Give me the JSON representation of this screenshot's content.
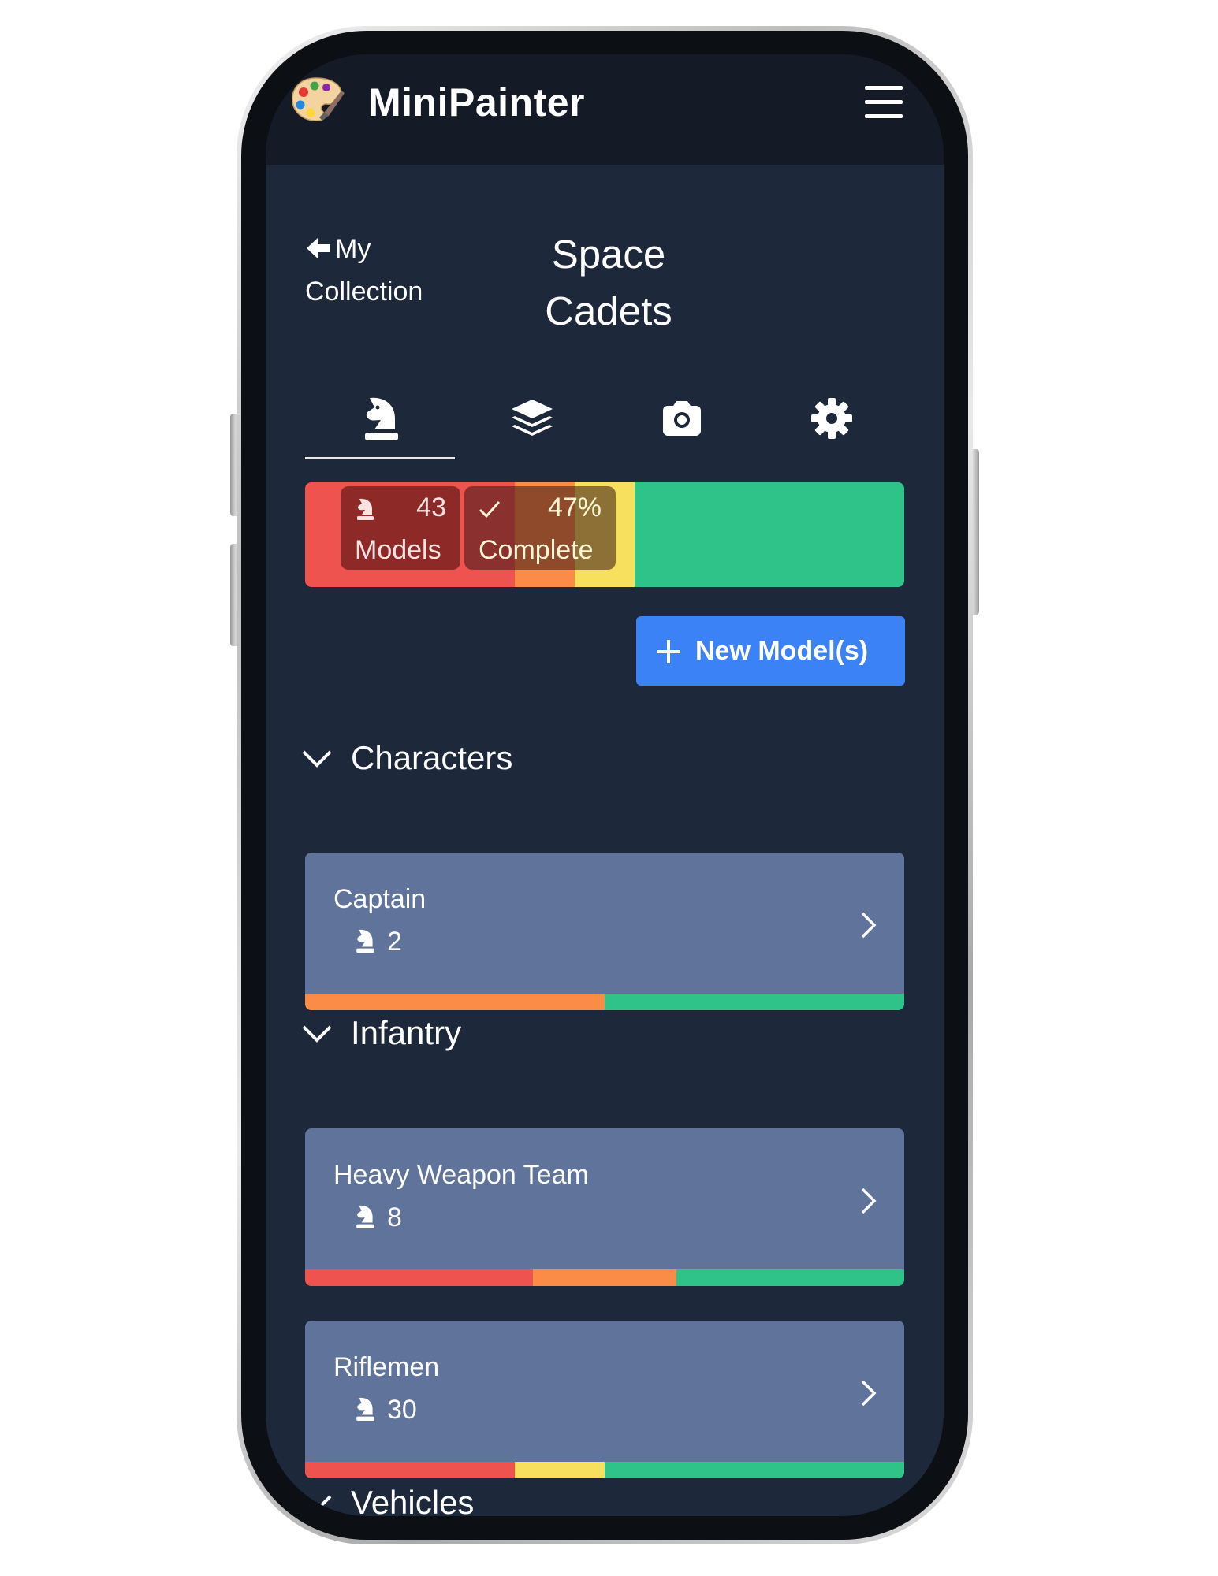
{
  "app": {
    "title": "MiniPainter",
    "logo_icon": "palette-icon",
    "menu_icon": "hamburger-menu-icon"
  },
  "nav": {
    "back_label": "My Collection",
    "back_icon": "arrow-left-icon"
  },
  "page": {
    "title": "Space Cadets"
  },
  "tabs": [
    {
      "icon": "chess-knight-icon",
      "active": true
    },
    {
      "icon": "layers-icon",
      "active": false
    },
    {
      "icon": "camera-icon",
      "active": false
    },
    {
      "icon": "gear-icon",
      "active": false
    }
  ],
  "summary": {
    "models_count": "43",
    "models_label": "Models",
    "complete_percent": "47%",
    "complete_label": "Complete",
    "progress": [
      {
        "status": "red",
        "fraction": 0.35
      },
      {
        "status": "orange",
        "fraction": 0.1
      },
      {
        "status": "yellow",
        "fraction": 0.1
      },
      {
        "status": "green",
        "fraction": 0.45
      }
    ]
  },
  "actions": {
    "new_model_label": "New Model(s)",
    "new_model_icon": "plus-icon"
  },
  "colors": {
    "red": "#ef5350",
    "orange": "#fb8c48",
    "yellow": "#f6e05e",
    "green": "#2fc38a",
    "accent_blue": "#3b82f6",
    "card_bg": "#60739a",
    "screen_bg": "#1e283b",
    "header_bg": "#141b27"
  },
  "sections": [
    {
      "title": "Characters",
      "items": [
        {
          "name": "Captain",
          "count": "2",
          "progress": [
            {
              "status": "orange",
              "fraction": 0.5
            },
            {
              "status": "green",
              "fraction": 0.5
            }
          ]
        }
      ]
    },
    {
      "title": "Infantry",
      "items": [
        {
          "name": "Heavy Weapon Team",
          "count": "8",
          "progress": [
            {
              "status": "red",
              "fraction": 0.38
            },
            {
              "status": "orange",
              "fraction": 0.24
            },
            {
              "status": "green",
              "fraction": 0.38
            }
          ]
        },
        {
          "name": "Riflemen",
          "count": "30",
          "progress": [
            {
              "status": "red",
              "fraction": 0.35
            },
            {
              "status": "yellow",
              "fraction": 0.15
            },
            {
              "status": "green",
              "fraction": 0.5
            }
          ]
        }
      ]
    },
    {
      "title": "Vehicles",
      "items": []
    }
  ]
}
